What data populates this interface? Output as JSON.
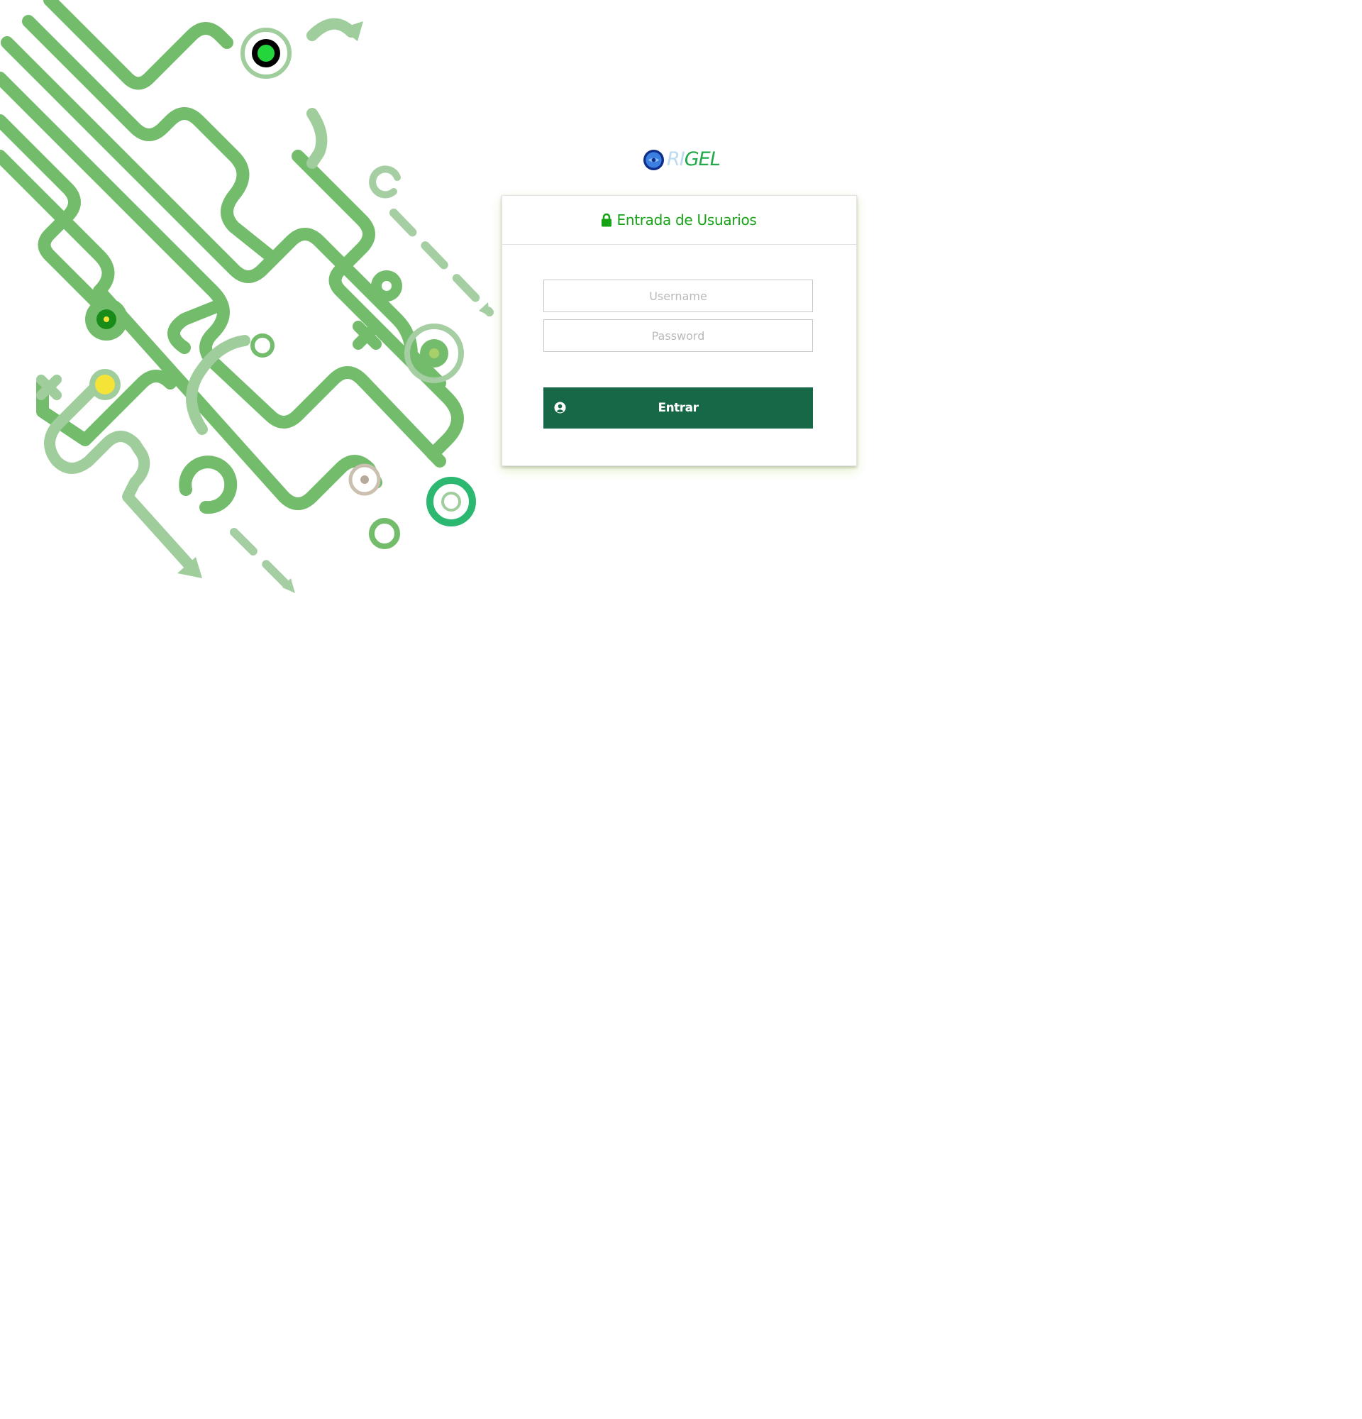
{
  "brand": {
    "name_part1": "RI",
    "name_part2": "GEL"
  },
  "login": {
    "title": "Entrada de Usuarios",
    "username_placeholder": "Username",
    "password_placeholder": "Password",
    "submit_label": "Entrar"
  },
  "icons": {
    "title_icon": "lock-icon",
    "submit_icon": "user-circle-icon",
    "logo_icon": "globe-emblem-icon"
  },
  "colors": {
    "accent_green": "#16a316",
    "button_green": "#176846",
    "logo_light_blue": "#bcdaf0",
    "decor_green": "#72bc6c",
    "decor_pale_green": "#9fcd9c"
  }
}
